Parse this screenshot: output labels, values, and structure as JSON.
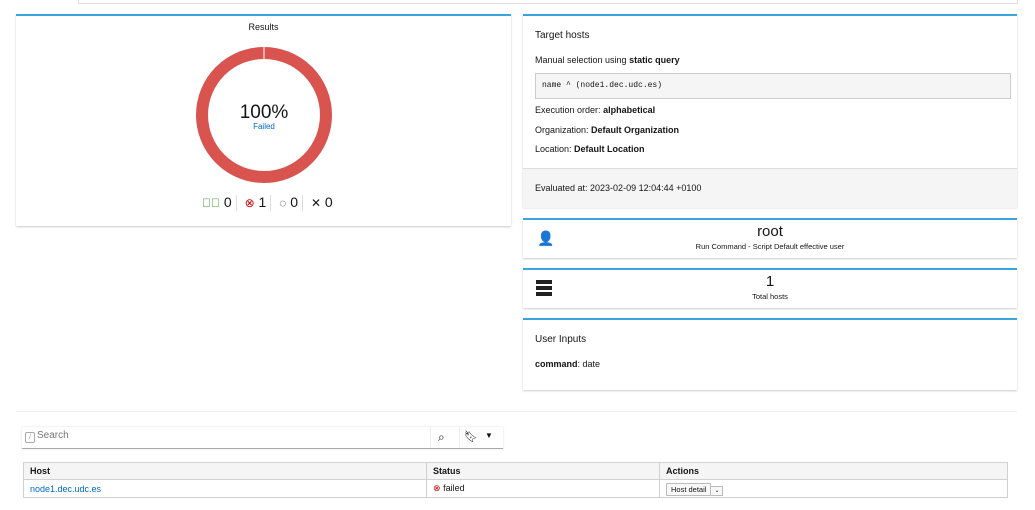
{
  "results": {
    "title": "Results",
    "percent": "100%",
    "label": "Failed",
    "counts": {
      "success": "0",
      "failed": "1",
      "pending": "0",
      "cancelled": "0"
    }
  },
  "target_hosts": {
    "title": "Target hosts",
    "selection_prefix": "Manual selection using",
    "selection_type": "static query",
    "query": "name ^ (node1.dec.udc.es)",
    "execution_order_label": "Execution order:",
    "execution_order": "alphabetical",
    "organization_label": "Organization:",
    "organization": "Default Organization",
    "location_label": "Location:",
    "location": "Default Location",
    "evaluated": "Evaluated at: 2023-02-09 12:04:44 +0100"
  },
  "user_card": {
    "value": "root",
    "caption": "Run Command - Script Default effective user"
  },
  "hosts_card": {
    "value": "1",
    "caption": "Total hosts"
  },
  "user_inputs": {
    "title": "User Inputs",
    "key": "command",
    "value": ": date"
  },
  "search": {
    "placeholder": "Search"
  },
  "table": {
    "headers": [
      "Host",
      "Status",
      "Actions"
    ],
    "rows": [
      {
        "host": "node1.dec.udc.es",
        "status": "failed",
        "action": "Host detail"
      }
    ]
  },
  "colors": {
    "failed": "#d9534f",
    "accent": "#39a5dc"
  }
}
